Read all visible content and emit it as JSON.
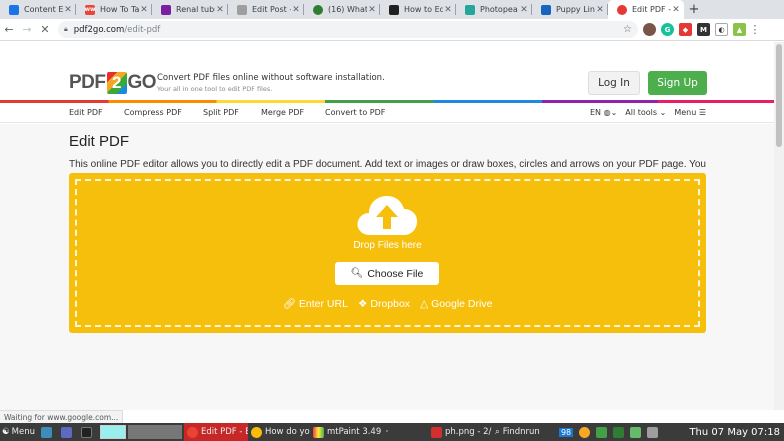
{
  "browser": {
    "tabs": [
      {
        "title": "Content E",
        "color": "#1a73e8"
      },
      {
        "title": "How To Ta",
        "color": "#e8453c",
        "badge": "ww"
      },
      {
        "title": "Renal tubu",
        "color": "#7b1fa2"
      },
      {
        "title": "Edit Post -",
        "color": "#9e9e9e"
      },
      {
        "title": "(16) What",
        "color": "#2e7d32"
      },
      {
        "title": "How to Ed",
        "color": "#212121"
      },
      {
        "title": "Photopea",
        "color": "#26a69a"
      },
      {
        "title": "Puppy Lin",
        "color": "#1565c0"
      },
      {
        "title": "Edit PDF -",
        "color": "#e53935",
        "active": true
      }
    ],
    "new_tab": "+",
    "url_host": "pdf2go.com",
    "url_path": "/edit-pdf"
  },
  "site": {
    "logo_pre": "PDF",
    "logo_num": "2",
    "logo_post": "GO",
    "tagline": "Convert PDF files online without software installation.",
    "subtagline": "Your all in one tool to edit PDF files.",
    "login": "Log In",
    "signup": "Sign Up",
    "nav": [
      "Edit PDF",
      "Compress PDF",
      "Split PDF",
      "Merge PDF",
      "Convert to PDF"
    ],
    "lang": "EN",
    "all_tools": "All tools",
    "menu": "Menu"
  },
  "main": {
    "title": "Edit PDF",
    "description": "This online PDF editor allows you to directly edit a PDF document. Add text or images or draw boxes, circles and arrows on your PDF page. You can also highlight passages or add a watermark to the PDF.",
    "drop_text": "Drop Files here",
    "choose_file": "Choose File",
    "sources": [
      "Enter URL",
      "Dropbox",
      "Google Drive"
    ]
  },
  "status": "Waiting for www.google.com...",
  "taskbar": {
    "menu": "Menu",
    "items": [
      "Edit PDF - Ec",
      "How do you",
      "mtPaint 3.49",
      "ph.png - 2/3",
      "Findnrun"
    ],
    "battery": "98",
    "clock": "Thu 07 May 07:18"
  },
  "colors": {
    "accent_yellow": "#f6bf0c",
    "signup_green": "#4cae4c"
  }
}
